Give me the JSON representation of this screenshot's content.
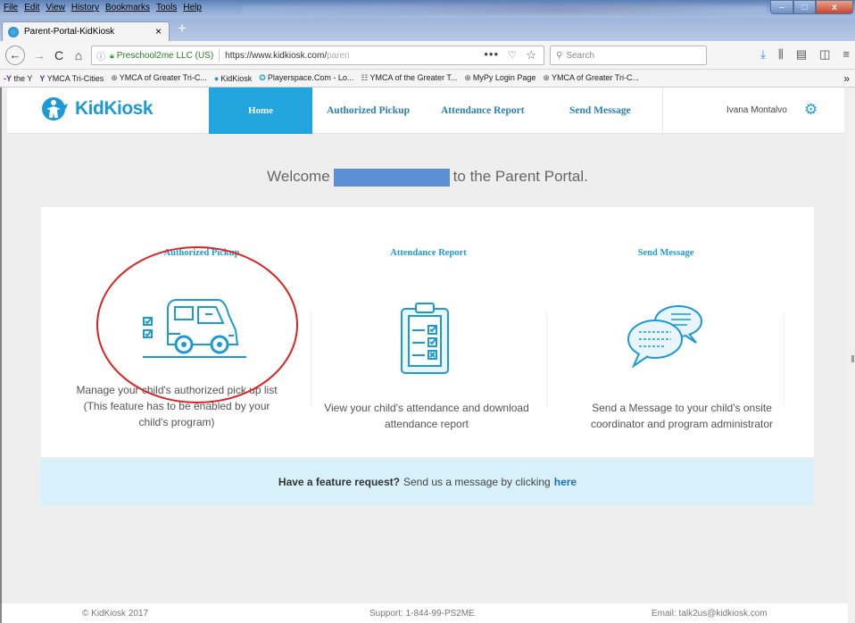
{
  "browser": {
    "menu": [
      "File",
      "Edit",
      "View",
      "History",
      "Bookmarks",
      "Tools",
      "Help"
    ],
    "window_controls": {
      "minimize": "–",
      "maximize": "□",
      "close": "x"
    },
    "tab": {
      "title": "Parent-Portal-KidKiosk",
      "close": "×",
      "new_tab": "+"
    },
    "nav": {
      "back": "←",
      "forward": "→",
      "reload": "C",
      "home": "⌂"
    },
    "urlbar": {
      "info": "ⓘ",
      "org": "Preschool2me LLC (US)",
      "url_host": "https://www.kidkiosk.com/",
      "url_path": "paren",
      "dots": "•••"
    },
    "search": {
      "placeholder": "Search"
    },
    "bookmarks": [
      {
        "label": "the Y"
      },
      {
        "label": "YMCA Tri-Cities"
      },
      {
        "label": "YMCA of Greater Tri-C..."
      },
      {
        "label": "KidKiosk"
      },
      {
        "label": "Playerspace.Com - Lo..."
      },
      {
        "label": "YMCA of the Greater T..."
      },
      {
        "label": "MyPy Login Page"
      },
      {
        "label": "YMCA of Greater Tri-C..."
      }
    ],
    "bookmarks_more": "»"
  },
  "site": {
    "logo_text": "KidKiosk",
    "nav": {
      "home": "Home",
      "authorized_pickup": "Authorized Pickup",
      "attendance_report": "Attendance Report",
      "send_message": "Send Message"
    },
    "user_name": "Ivana Montalvo",
    "welcome": {
      "prefix": "Welcome",
      "suffix": "to the Parent Portal."
    },
    "features": [
      {
        "title": "Authorized Pickup",
        "icon": "pickup-van-icon",
        "desc_lines": [
          "Manage your child's authorized pick up list",
          "(This feature has to be enabled by your",
          "child's program)"
        ]
      },
      {
        "title": "Attendance Report",
        "icon": "clipboard-checklist-icon",
        "desc_lines": [
          "View your child's attendance and download",
          "attendance report"
        ]
      },
      {
        "title": "Send Message",
        "icon": "chat-bubbles-icon",
        "desc_lines": [
          "Send a Message to your child's onsite",
          "coordinator and program administrator"
        ]
      }
    ],
    "banner": {
      "strong": "Have a feature request?",
      "text": "Send us a message by clicking",
      "link": "here"
    },
    "footer": {
      "copyright": "© KidKiosk 2017",
      "support": "Support: 1-844-99-PS2ME",
      "email": "Email: talk2us@kidkiosk.com"
    }
  },
  "colors": {
    "brand_blue": "#22a4df",
    "banner_bg": "#d7f0f9",
    "annotation_red": "#e02020"
  }
}
